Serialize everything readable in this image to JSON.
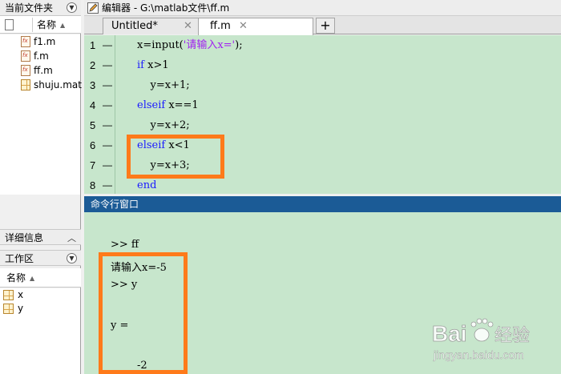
{
  "current_folder": {
    "title": "当前文件夹",
    "column_name": "名称",
    "files": [
      {
        "name": "f1.m",
        "icon": "m-file-icon"
      },
      {
        "name": "f.m",
        "icon": "m-file-icon"
      },
      {
        "name": "ff.m",
        "icon": "m-file-icon"
      },
      {
        "name": "shuju.mat",
        "icon": "mat-file-icon"
      }
    ]
  },
  "details": {
    "title": "详细信息"
  },
  "workspace": {
    "title": "工作区",
    "column_name": "名称",
    "variables": [
      {
        "name": "x",
        "icon": "variable-icon"
      },
      {
        "name": "y",
        "icon": "variable-icon"
      }
    ]
  },
  "editor": {
    "title": "编辑器 - G:\\matlab文件\\ff.m",
    "tabs": [
      {
        "label": "Untitled*",
        "active": false
      },
      {
        "label": "ff.m",
        "active": true
      }
    ],
    "add_tab": "+",
    "lines": [
      {
        "num": "1",
        "dash": "—",
        "parts": [
          {
            "t": "x=input(",
            "c": ""
          },
          {
            "t": "'请输入x='",
            "c": "str"
          },
          {
            "t": ");",
            "c": ""
          }
        ]
      },
      {
        "num": "2",
        "dash": "—",
        "parts": [
          {
            "t": "if",
            "c": "kw"
          },
          {
            "t": " x>1",
            "c": ""
          }
        ]
      },
      {
        "num": "3",
        "dash": "—",
        "parts": [
          {
            "t": "    y=x+1;",
            "c": ""
          }
        ]
      },
      {
        "num": "4",
        "dash": "—",
        "parts": [
          {
            "t": "elseif",
            "c": "kw"
          },
          {
            "t": " x==1",
            "c": ""
          }
        ]
      },
      {
        "num": "5",
        "dash": "—",
        "parts": [
          {
            "t": "    y=x+2;",
            "c": ""
          }
        ]
      },
      {
        "num": "6",
        "dash": "—",
        "parts": [
          {
            "t": "elseif",
            "c": "kw"
          },
          {
            "t": " x<1",
            "c": ""
          }
        ]
      },
      {
        "num": "7",
        "dash": "—",
        "parts": [
          {
            "t": "    y=x+3;",
            "c": ""
          }
        ]
      },
      {
        "num": "8",
        "dash": "—",
        "parts": [
          {
            "t": "end",
            "c": "kw"
          }
        ]
      }
    ]
  },
  "command_window": {
    "title": "命令行窗口",
    "lines": [
      ">> ff",
      "请输入x=-5",
      ">> y",
      "y =",
      "-2"
    ]
  },
  "watermark": {
    "brand": "Bai",
    "brand2": "经验",
    "url": "jingyan.baidu.com"
  },
  "colors": {
    "code_bg": "#c7e6cc",
    "keyword": "#1a1aff",
    "string": "#a020f0",
    "highlight": "#ff7a1a",
    "cmd_title_bg": "#1b5b96"
  }
}
